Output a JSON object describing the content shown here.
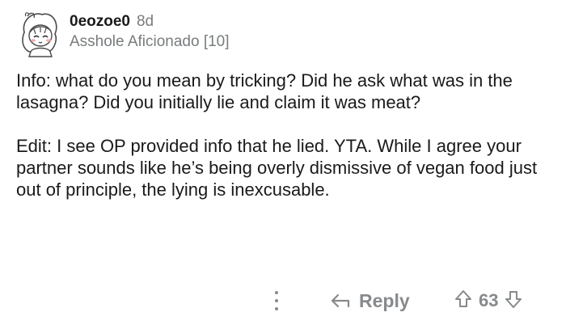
{
  "comment": {
    "username": "0eozoe0",
    "age": "8d",
    "flair": "Asshole Aficionado [10]",
    "paragraphs": [
      "Info: what do you mean by tricking? Did he ask what was in the lasagna? Did you initially lie and claim it was meat?",
      "Edit: I see OP provided info that he lied. YTA. While I agree your partner sounds like he’s being overly dismissive of vegan food just out of principle, the lying is inexcusable."
    ]
  },
  "actions": {
    "reply_label": "Reply",
    "score": "63"
  },
  "icons": {
    "more": "more-options-icon",
    "reply": "reply-arrow-icon",
    "upvote": "upvote-arrow-icon",
    "downvote": "downvote-arrow-icon",
    "avatar": "snoo-avatar"
  },
  "colors": {
    "text": "#1a1a1b",
    "muted": "#787c7e",
    "icon": "#878a8c"
  }
}
